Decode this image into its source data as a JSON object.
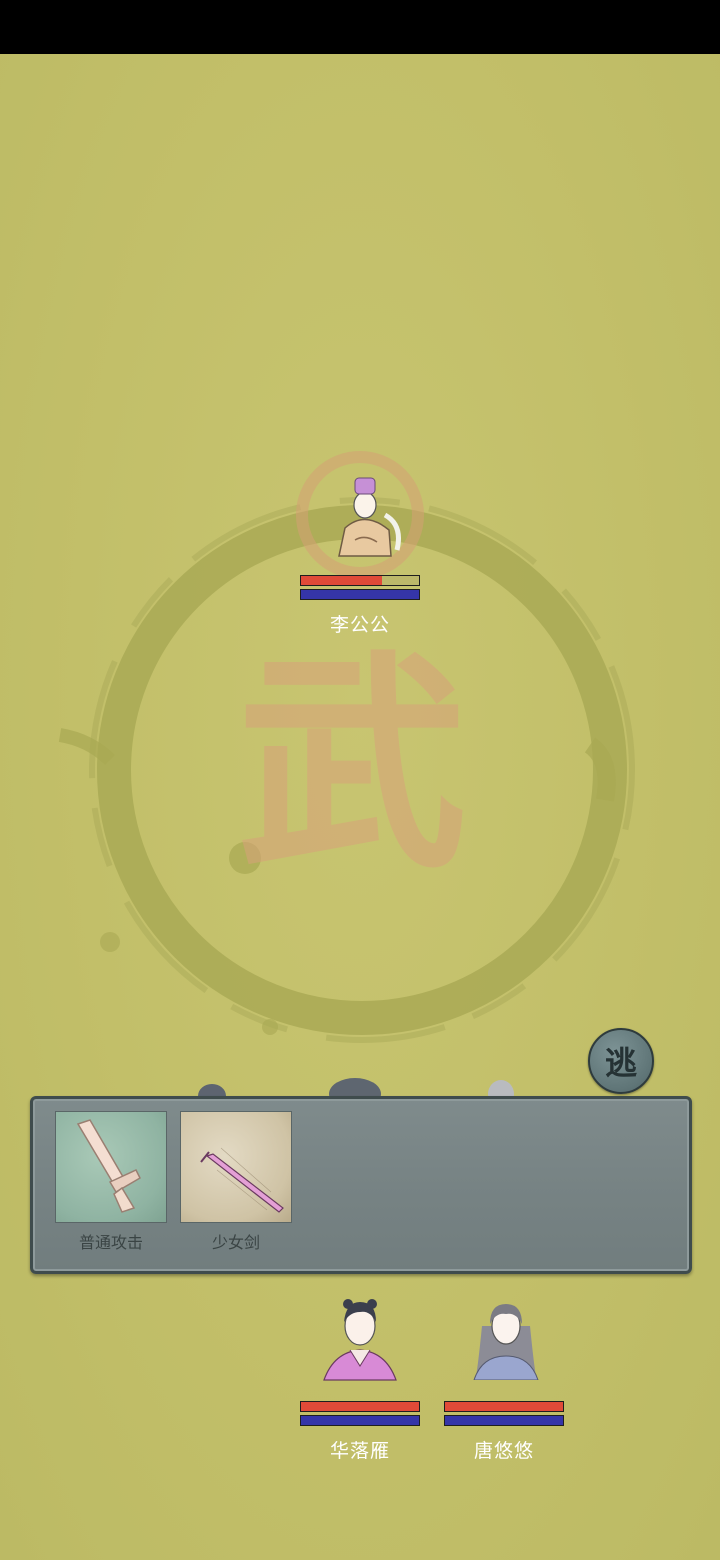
{
  "enemies": [
    {
      "name": "李公公",
      "hp": 0.69,
      "mp": 1.0,
      "portrait_icon": "eunuch-portrait"
    }
  ],
  "allies": [
    {
      "name": "华落雁",
      "hp": 1.0,
      "mp": 1.0,
      "portrait_icon": "girl-pink-robe-portrait"
    },
    {
      "name": "唐悠悠",
      "hp": 1.0,
      "mp": 1.0,
      "portrait_icon": "girl-long-hair-portrait"
    }
  ],
  "flee_button": {
    "label": "逃"
  },
  "skills": [
    {
      "label": "普通攻击",
      "icon": "sword-icon"
    },
    {
      "label": "少女剑",
      "icon": "pink-sword-icon"
    }
  ],
  "background": {
    "seal_char": "武"
  },
  "colors": {
    "hp": "#e04a38",
    "mp": "#3535a8",
    "background": "#c3c26c",
    "panel": "#7b8788"
  }
}
